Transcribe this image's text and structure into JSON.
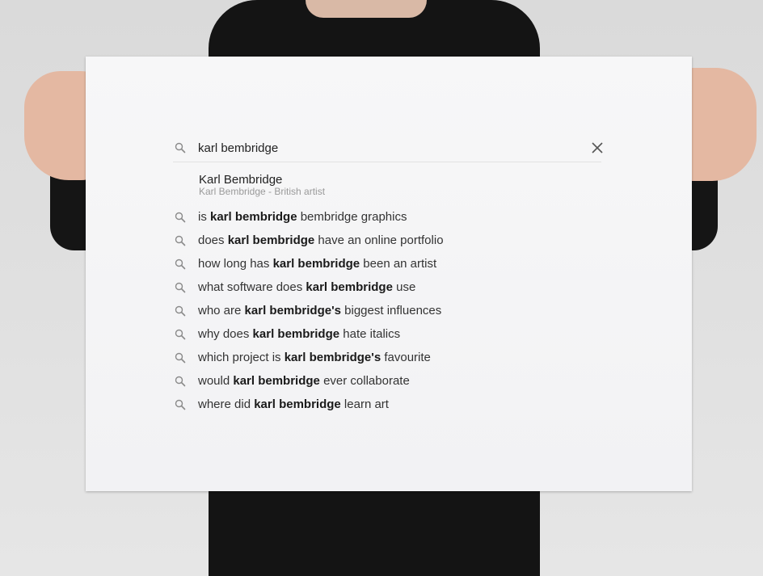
{
  "search": {
    "query": "karl bembridge",
    "icons": {
      "search": "search-icon",
      "clear": "close-icon"
    }
  },
  "entity": {
    "title": "Karl Bembridge",
    "subtitle": "Karl Bembridge - British artist"
  },
  "suggestions": [
    {
      "before": "is ",
      "bold": "karl bembridge",
      "after": " bembridge graphics"
    },
    {
      "before": "does ",
      "bold": "karl bembridge",
      "after": " have an online portfolio"
    },
    {
      "before": "how long has ",
      "bold": "karl bembridge",
      "after": " been an artist"
    },
    {
      "before": "what software does ",
      "bold": "karl bembridge",
      "after": " use"
    },
    {
      "before": "who are ",
      "bold": "karl bembridge's",
      "after": " biggest influences"
    },
    {
      "before": "why does ",
      "bold": "karl bembridge",
      "after": " hate italics"
    },
    {
      "before": "which project is ",
      "bold": "karl bembridge's",
      "after": " favourite"
    },
    {
      "before": "would ",
      "bold": "karl bembridge",
      "after": " ever collaborate"
    },
    {
      "before": "where did ",
      "bold": "karl bembridge",
      "after": " learn art"
    }
  ],
  "colors": {
    "icon": "#8a8a8a",
    "text": "#333333",
    "poster": "#f5f5f6"
  }
}
